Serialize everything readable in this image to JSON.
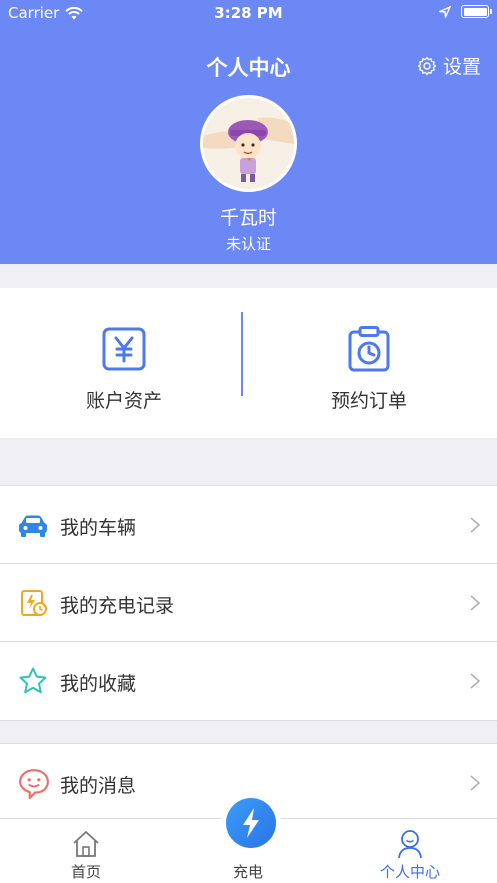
{
  "status_bar": {
    "carrier": "Carrier",
    "time": "3:28 PM"
  },
  "header": {
    "title": "个人中心",
    "settings_label": "设置"
  },
  "profile": {
    "name": "千瓦时",
    "status": "未认证"
  },
  "assets": [
    {
      "label": "账户资产",
      "icon": "yuan-icon"
    },
    {
      "label": "预约订单",
      "icon": "clipboard-clock-icon"
    }
  ],
  "menu": {
    "group1": [
      {
        "label": "我的车辆",
        "icon": "car-icon"
      },
      {
        "label": "我的充电记录",
        "icon": "charge-record-icon"
      },
      {
        "label": "我的收藏",
        "icon": "star-icon"
      }
    ],
    "group2": [
      {
        "label": "我的消息",
        "icon": "message-icon"
      }
    ]
  },
  "tabbar": [
    {
      "label": "首页",
      "icon": "home-icon"
    },
    {
      "label": "充电",
      "icon": "lightning-icon"
    },
    {
      "label": "个人中心",
      "icon": "person-icon",
      "active": true
    }
  ],
  "colors": {
    "header": "#6c88f5",
    "accent": "#3a6ff2"
  }
}
